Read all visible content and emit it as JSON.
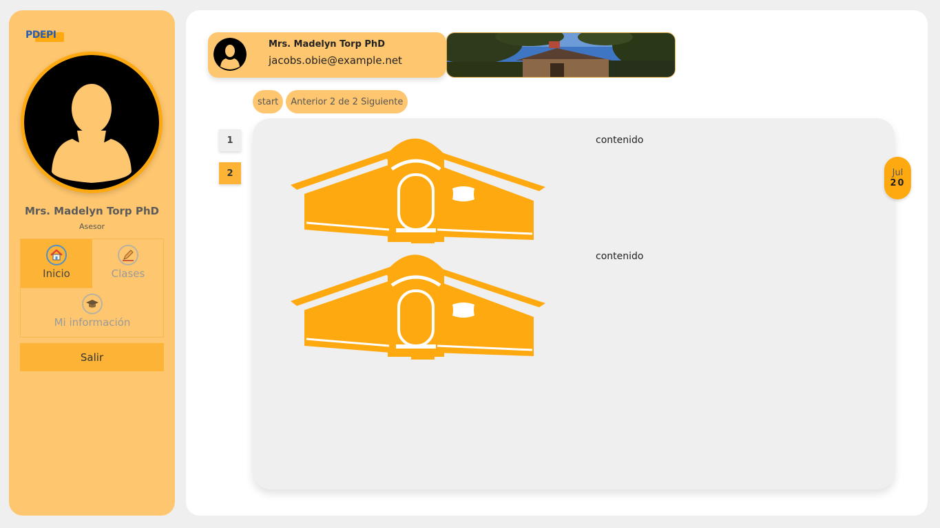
{
  "sidebar": {
    "logo_text": "PDEPI",
    "user_name": "Mrs. Madelyn Torp PhD",
    "user_role": "Asesor",
    "menu": [
      {
        "label": "Inicio",
        "icon": "home-icon",
        "active": true
      },
      {
        "label": "Clases",
        "icon": "pencil-icon",
        "active": false
      },
      {
        "label": "Mi información",
        "icon": "graduation-cap-icon",
        "active": false
      }
    ],
    "logout_label": "Salir"
  },
  "header": {
    "name": "Mrs. Madelyn Torp PhD",
    "email": "jacobs.obie@example.net",
    "banner_image": "building-trees-photo"
  },
  "pagination": {
    "start_label": "start",
    "nav_label": "Anterior 2 de 2 Siguiente",
    "tabs": [
      "1",
      "2"
    ],
    "active_tab": "2"
  },
  "posts": [
    {
      "image": "building-facade-illustration",
      "text": "contenido"
    },
    {
      "image": "building-facade-illustration",
      "text": "contenido"
    }
  ],
  "date": {
    "month": "Jul",
    "day": "20"
  },
  "colors": {
    "sidebar_bg": "#fec66f",
    "accent": "#ffa911",
    "active_menu": "#fdb336",
    "panel_bg": "#efefef",
    "page_bg": "#efefef"
  }
}
